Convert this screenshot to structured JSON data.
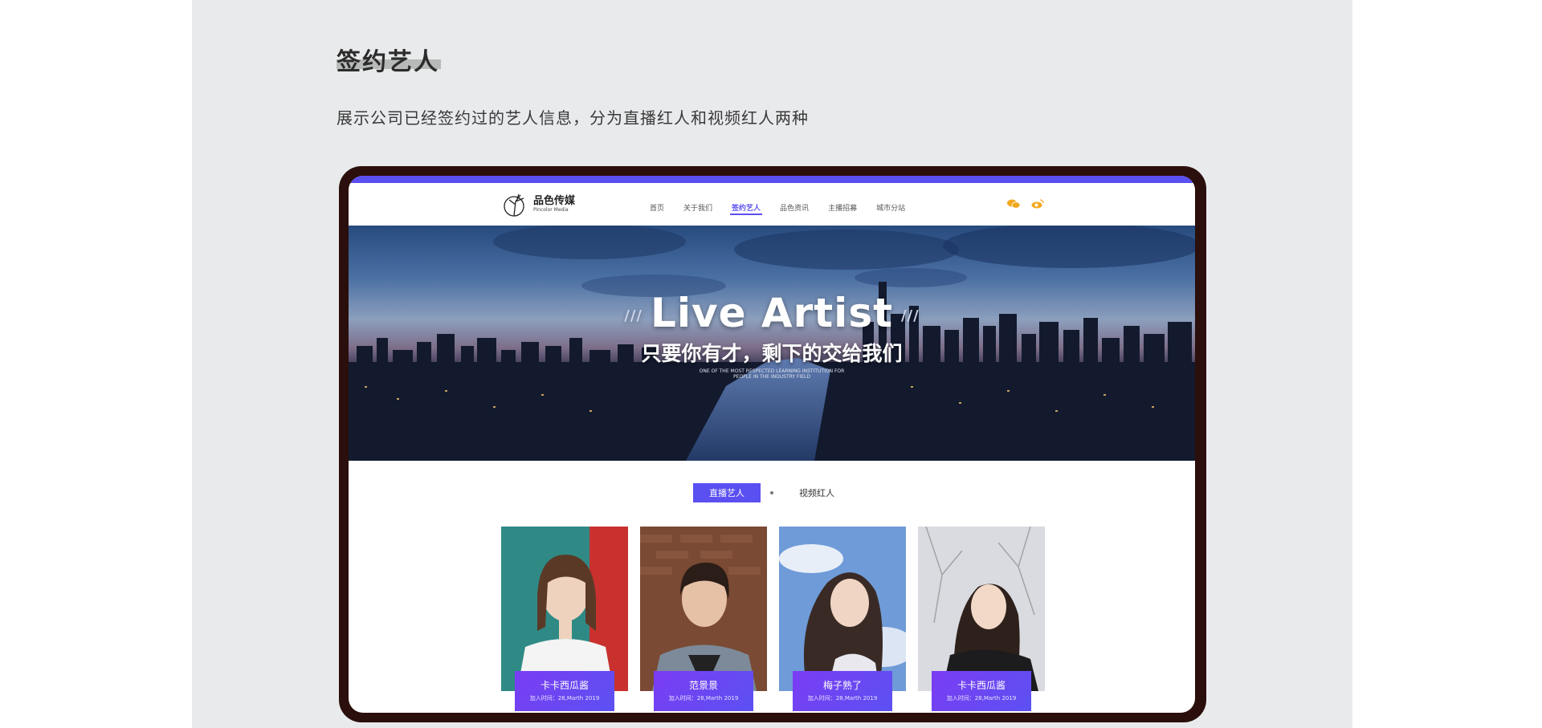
{
  "section": {
    "title": "签约艺人",
    "description": "展示公司已经签约过的艺人信息，分为直播红人和视频红人两种"
  },
  "site": {
    "logo_cn": "品色传媒",
    "logo_en": "Pincolor Media",
    "accent_color": "#5a4ff0",
    "nav": [
      {
        "label": "首页"
      },
      {
        "label": "关于我们"
      },
      {
        "label": "签约艺人",
        "active": true
      },
      {
        "label": "品色资讯"
      },
      {
        "label": "主播招募"
      },
      {
        "label": "城市分站"
      }
    ],
    "social_icons": [
      "wechat-icon",
      "weibo-icon"
    ]
  },
  "hero": {
    "title": "Live Artist",
    "slash_left": "///",
    "slash_right": "///",
    "subtitle": "只要你有才，剩下的交给我们",
    "small_line1": "ONE OF THE MOST RESPECTED LEARNING INSTITUTION FOR",
    "small_line2": "PEOPLE IN THE INDUSTRY FIELD"
  },
  "tabs": [
    {
      "label": "直播艺人",
      "active": true
    },
    {
      "label": "视频红人",
      "active": false
    }
  ],
  "artists": [
    {
      "name": "卡卡西瓜酱",
      "date": "加入时间：28,Marth 2019"
    },
    {
      "name": "范景景",
      "date": "加入时间：28,Marth 2019"
    },
    {
      "name": "梅子熟了",
      "date": "加入时间：28,Marth 2019"
    },
    {
      "name": "卡卡西瓜酱",
      "date": "加入时间：28,Marth 2019"
    }
  ]
}
